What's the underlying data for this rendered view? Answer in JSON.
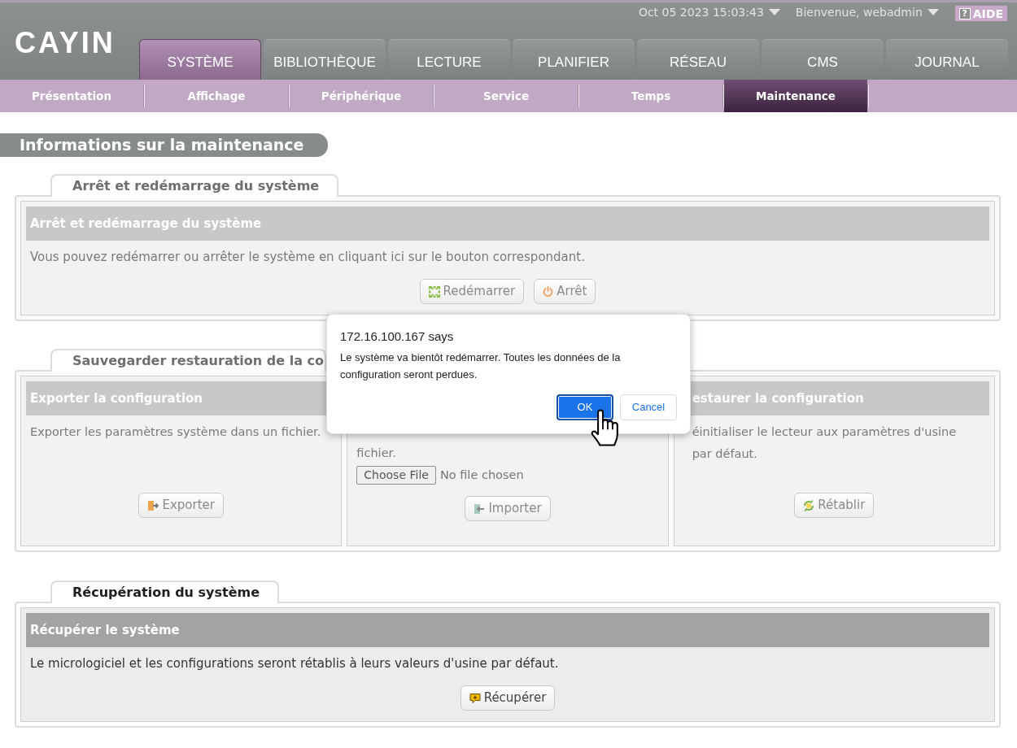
{
  "header": {
    "logo": "CAYIN",
    "datetime": "Oct 05 2023 15:03:43",
    "user_menu": "Bienvenue, webadmin",
    "help": {
      "icon": "?",
      "label": "AIDE"
    }
  },
  "main_tabs": [
    {
      "label": "SYSTÈME",
      "selected": true
    },
    {
      "label": "BIBLIOTHÈQUE",
      "selected": false
    },
    {
      "label": "LECTURE",
      "selected": false
    },
    {
      "label": "PLANIFIER",
      "selected": false
    },
    {
      "label": "RÉSEAU",
      "selected": false
    },
    {
      "label": "CMS",
      "selected": false
    },
    {
      "label": "JOURNAL",
      "selected": false
    }
  ],
  "sub_tabs": [
    {
      "label": "Présentation",
      "selected": false
    },
    {
      "label": "Affichage",
      "selected": false
    },
    {
      "label": "Périphérique",
      "selected": false
    },
    {
      "label": "Service",
      "selected": false
    },
    {
      "label": "Temps",
      "selected": false
    },
    {
      "label": "Maintenance",
      "selected": true
    }
  ],
  "page_title": "Informations sur la maintenance",
  "sections": [
    {
      "title": "Arrêt et redémarrage du système",
      "disabled": true,
      "panels": [
        {
          "heading": "Arrêt et redémarrage du système",
          "text": "Vous pouvez redémarrer ou arrêter le système en cliquant ici sur le bouton correspondant.",
          "buttons": [
            {
              "label": "Redémarrer",
              "kind": "restart"
            },
            {
              "label": "Arrêt",
              "kind": "shutdown"
            }
          ]
        }
      ]
    },
    {
      "title": "Sauvegarder restauration de la co",
      "disabled": true,
      "panels": [
        {
          "heading": "Exporter la configuration",
          "text": "Exporter les paramètres système dans un fichier.",
          "buttons": [
            {
              "label": "Exporter",
              "kind": "export"
            }
          ]
        },
        {
          "text": "fichier.",
          "file_input": {
            "button": "Choose File",
            "status": "No file chosen"
          },
          "buttons": [
            {
              "label": "Importer",
              "kind": "import"
            }
          ]
        },
        {
          "heading": "estaurer la configuration",
          "text": "éinitialiser le lecteur aux paramètres d'usine par défaut.",
          "buttons": [
            {
              "label": "Rétablir",
              "kind": "restore"
            }
          ]
        }
      ]
    },
    {
      "title": "Récupération du système",
      "disabled": false,
      "panels": [
        {
          "heading": "Récupérer le système",
          "text": "Le micrologiciel et les configurations seront rétablis à leurs valeurs d'usine par défaut.",
          "buttons": [
            {
              "label": "Récupérer",
              "kind": "recover"
            }
          ]
        }
      ]
    }
  ],
  "dialog": {
    "title": "172.16.100.167 says",
    "message": "Le système va bientôt redémarrer. Toutes les données de la configuration seront perdues.",
    "buttons": [
      {
        "label": "OK",
        "kind": "primary",
        "focused": true
      },
      {
        "label": "Cancel",
        "kind": "secondary",
        "focused": false
      }
    ]
  }
}
